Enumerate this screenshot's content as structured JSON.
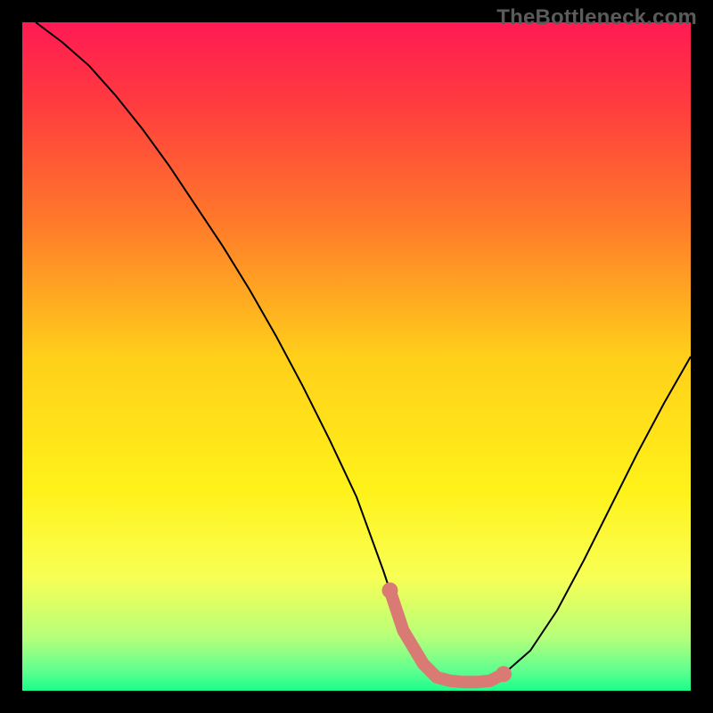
{
  "watermark": "TheBottleneck.com",
  "colors": {
    "background": "#000000",
    "gradient_stops": [
      {
        "offset": 0.0,
        "color": "#ff1a54"
      },
      {
        "offset": 0.12,
        "color": "#ff3b3f"
      },
      {
        "offset": 0.3,
        "color": "#ff7a2a"
      },
      {
        "offset": 0.5,
        "color": "#ffcf1a"
      },
      {
        "offset": 0.7,
        "color": "#fff21a"
      },
      {
        "offset": 0.83,
        "color": "#f8ff55"
      },
      {
        "offset": 0.92,
        "color": "#b6ff7a"
      },
      {
        "offset": 0.97,
        "color": "#5fff8f"
      },
      {
        "offset": 1.0,
        "color": "#1aff8a"
      }
    ],
    "curve_stroke": "#000000",
    "highlight_stroke": "#d97a74",
    "highlight_fill": "#d97a74"
  },
  "chart_data": {
    "type": "line",
    "title": "",
    "xlabel": "",
    "ylabel": "",
    "xlim": [
      0,
      100
    ],
    "ylim": [
      0,
      100
    ],
    "series": [
      {
        "name": "curve",
        "x": [
          2,
          6,
          10,
          14,
          18,
          22,
          26,
          30,
          34,
          38,
          42,
          46,
          50,
          54,
          55,
          57,
          60,
          62,
          64,
          66,
          68,
          70,
          72,
          76,
          80,
          84,
          88,
          92,
          96,
          100
        ],
        "y": [
          100,
          97,
          93.5,
          89,
          84,
          78.5,
          72.5,
          66.5,
          60,
          53,
          45.5,
          37.5,
          29,
          18,
          15,
          9,
          4,
          2,
          1.5,
          1.3,
          1.3,
          1.5,
          2.5,
          6,
          12,
          19.5,
          27.5,
          35.5,
          43,
          50
        ]
      }
    ],
    "highlight": {
      "x_range": [
        55,
        72
      ],
      "endpoints": [
        {
          "x": 55,
          "y": 15
        },
        {
          "x": 72,
          "y": 2.5
        }
      ],
      "points": [
        {
          "x": 55,
          "y": 15
        },
        {
          "x": 57,
          "y": 9
        },
        {
          "x": 60,
          "y": 4
        },
        {
          "x": 62,
          "y": 2
        },
        {
          "x": 64,
          "y": 1.5
        },
        {
          "x": 66,
          "y": 1.3
        },
        {
          "x": 68,
          "y": 1.3
        },
        {
          "x": 70,
          "y": 1.5
        },
        {
          "x": 72,
          "y": 2.5
        }
      ]
    }
  }
}
